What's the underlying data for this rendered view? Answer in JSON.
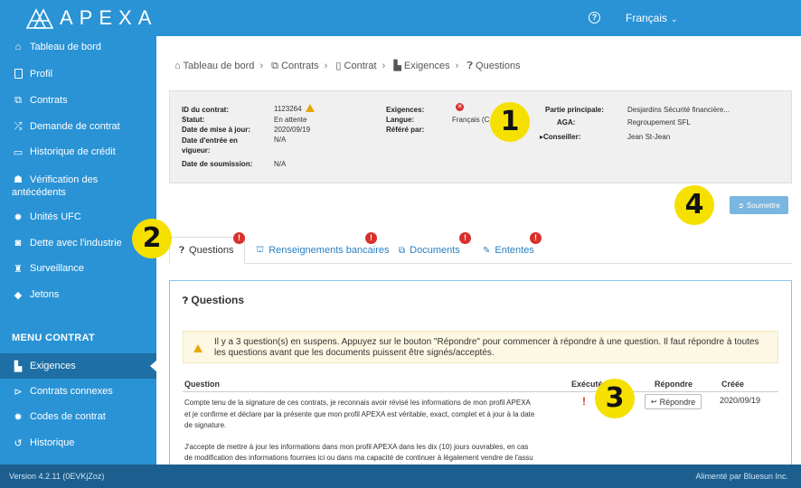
{
  "header": {
    "brand": "APEXA",
    "help_icon": "?",
    "language": "Français",
    "language_chevron": "⌄"
  },
  "sidebar": {
    "items": [
      {
        "icon": "home-icon",
        "glyph": "⌂",
        "label": "Tableau de bord"
      },
      {
        "icon": "profile-icon",
        "glyph": "",
        "label": "Profil"
      },
      {
        "icon": "contracts-icon",
        "glyph": "⧉",
        "label": "Contrats"
      },
      {
        "icon": "shuffle-icon",
        "glyph": "⤮",
        "label": "Demande de contrat"
      },
      {
        "icon": "credit-card-icon",
        "glyph": "▭",
        "label": "Historique de crédit"
      },
      {
        "icon": "user-secret-icon",
        "glyph": "☗",
        "label": "Vérification des antécédents"
      },
      {
        "icon": "certificate-icon",
        "glyph": "✹",
        "label": "Unités UFC"
      },
      {
        "icon": "debt-icon",
        "glyph": "◙",
        "label": "Dette avec l'industrie"
      },
      {
        "icon": "binoculars-icon",
        "glyph": "♜",
        "label": "Surveillance"
      },
      {
        "icon": "tag-icon",
        "glyph": "◆",
        "label": "Jetons"
      }
    ],
    "menu_header": "MENU CONTRAT",
    "contract_items": [
      {
        "icon": "requirements-icon",
        "glyph": "▙",
        "label": "Exigences",
        "active": true
      },
      {
        "icon": "folder-open-icon",
        "glyph": "⊳",
        "label": "Contrats connexes"
      },
      {
        "icon": "certificate-icon",
        "glyph": "✹",
        "label": "Codes de contrat"
      },
      {
        "icon": "history-icon",
        "glyph": "↺",
        "label": "Historique"
      }
    ]
  },
  "breadcrumb": {
    "items": [
      "Tableau de bord",
      "Contrats",
      "Contrat",
      "Exigences",
      "Questions"
    ],
    "separator": "›"
  },
  "contract_info": {
    "contract_id_label": "ID du contrat:",
    "contract_id": "1123264",
    "status_label": "Statut:",
    "status": "En attente",
    "updated_label": "Date de mise à jour:",
    "updated": "2020/09/19",
    "effective_label": "Date d'entrée en vigueur:",
    "effective": "N/A",
    "submitted_label": "Date de soumission:",
    "submitted": "N/A",
    "requirements_label": "Exigences:",
    "language_label": "Langue:",
    "language": "Français (C",
    "referred_label": "Référé par:",
    "main_party_label": "Partie principale:",
    "main_party": "Desjardins Sécurité financière...",
    "aga_label": "AGA:",
    "aga": "Regroupement SFL",
    "advisor_label": "Conseiller:",
    "advisor": "Jean St-Jean"
  },
  "callouts": [
    "1",
    "2",
    "3",
    "4"
  ],
  "submit_button": "Soumettre",
  "tabs": [
    {
      "label": "Questions",
      "icon": "question-circle-icon",
      "active": true,
      "alert": "!"
    },
    {
      "label": "Renseignements bancaires",
      "icon": "bank-icon",
      "active": false,
      "alert": "!"
    },
    {
      "label": "Documents",
      "icon": "documents-icon",
      "active": false,
      "alert": "!"
    },
    {
      "label": "Ententes",
      "icon": "edit-icon",
      "active": false,
      "alert": "!"
    }
  ],
  "questions_panel": {
    "title": "Questions",
    "alert_text": "Il y a 3 question(s) en suspens. Appuyez sur le bouton \"Répondre\" pour commencer à répondre à une question. Il faut répondre à toutes les questions avant que les documents puissent être signés/acceptés.",
    "columns": [
      "Question",
      "Exécuté",
      "Répondre",
      "Créée"
    ],
    "rows": [
      {
        "question_p1": "Compte tenu de la signature de ces contrats, je reconnais avoir révisé les informations de mon profil APEXA et je confirme et déclare par la présente que mon profil APEXA est véritable, exact, complet et à jour à la date de signature.",
        "question_p2": "J'accepte de mettre à jour les informations dans mon profil APEXA dans les dix (10) jours ouvrables, en cas de modification des informations fournies ici ou dans ma capacité de continuer à légalement vendre de l'assu",
        "executed": "!",
        "answer_button": "Répondre",
        "created": "2020/09/19"
      }
    ]
  },
  "footer": {
    "version": "Version 4.2.11 (0EVKjZoz)",
    "powered_by": "Alimenté par Bluesun Inc."
  },
  "colors": {
    "primary": "#2a93d5",
    "sidebar_active": "#1d6fa6",
    "footer": "#1c5f8f",
    "danger": "#d9302c",
    "warning": "#e6a800",
    "callout": "#f5e000"
  }
}
